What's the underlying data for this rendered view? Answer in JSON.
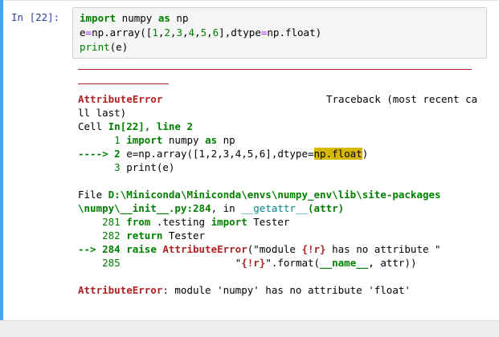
{
  "cell": {
    "prompt": "In  [22]:",
    "input_lines": [
      [
        "import",
        " numpy ",
        "as",
        " np"
      ],
      [
        "e",
        "=",
        "np.array([",
        "1",
        ",",
        "2",
        ",",
        "3",
        ",",
        "4",
        ",",
        "5",
        ",",
        "6",
        "],dtype",
        "=",
        "np.float)"
      ],
      [
        "print",
        "(e)"
      ]
    ]
  },
  "traceback": {
    "error_name": "AttributeError",
    "header_right": "Traceback (most recent ca",
    "header_wrap": "ll last)",
    "cell_ref_prefix": "Cell ",
    "cell_ref": "In[22], line 2",
    "frame1_lines": {
      "l1_num": "      1 ",
      "l1_kw1": "import",
      "l1_mid": " numpy ",
      "l1_kw2": "as",
      "l1_end": " np",
      "arrow1": "----> ",
      "l2_num": "2",
      "l2_text_a": " e=np.array([1,2,3,4,5,6],dtype=",
      "l2_highlight": "np.float",
      "l2_text_b": ")",
      "l3_num": "      3 ",
      "l3_text": "print(e)"
    },
    "file_prefix": "File ",
    "file_path_1": "D:\\Miniconda\\Miniconda\\envs\\numpy_env\\lib\\site-packages",
    "file_path_2": "\\numpy\\__init__.py:284",
    "file_in": ", in ",
    "file_func": "__getattr__",
    "file_args": "(attr)",
    "frame2": {
      "l281_num": "    281 ",
      "l281_kw": "from",
      "l281_mod": " .testing ",
      "l281_kw2": "import",
      "l281_end": " Tester",
      "l282_num": "    282 ",
      "l282_kw": "return",
      "l282_end": " Tester",
      "arrow2": "--> ",
      "l284_num": "284",
      "l284_kw": " raise ",
      "l284_err": "AttributeError",
      "l284_a": "(\"module ",
      "l284_fmt": "{!r}",
      "l284_b": " has no attribute \"",
      "l285_num": "    285 ",
      "l285_pad": "                  ",
      "l285_a": "\"",
      "l285_fmt": "{!r}",
      "l285_b": "\".format(",
      "l285_name": "__name__",
      "l285_c": ", attr))"
    },
    "final_error": "AttributeError",
    "final_msg": ": module 'numpy' has no attribute 'float'"
  },
  "colors": {
    "cell_border": "#42a5f5",
    "prompt": "#303f9f",
    "error": "#b22222",
    "keyword": "#008000",
    "highlight": "#d6b800"
  }
}
